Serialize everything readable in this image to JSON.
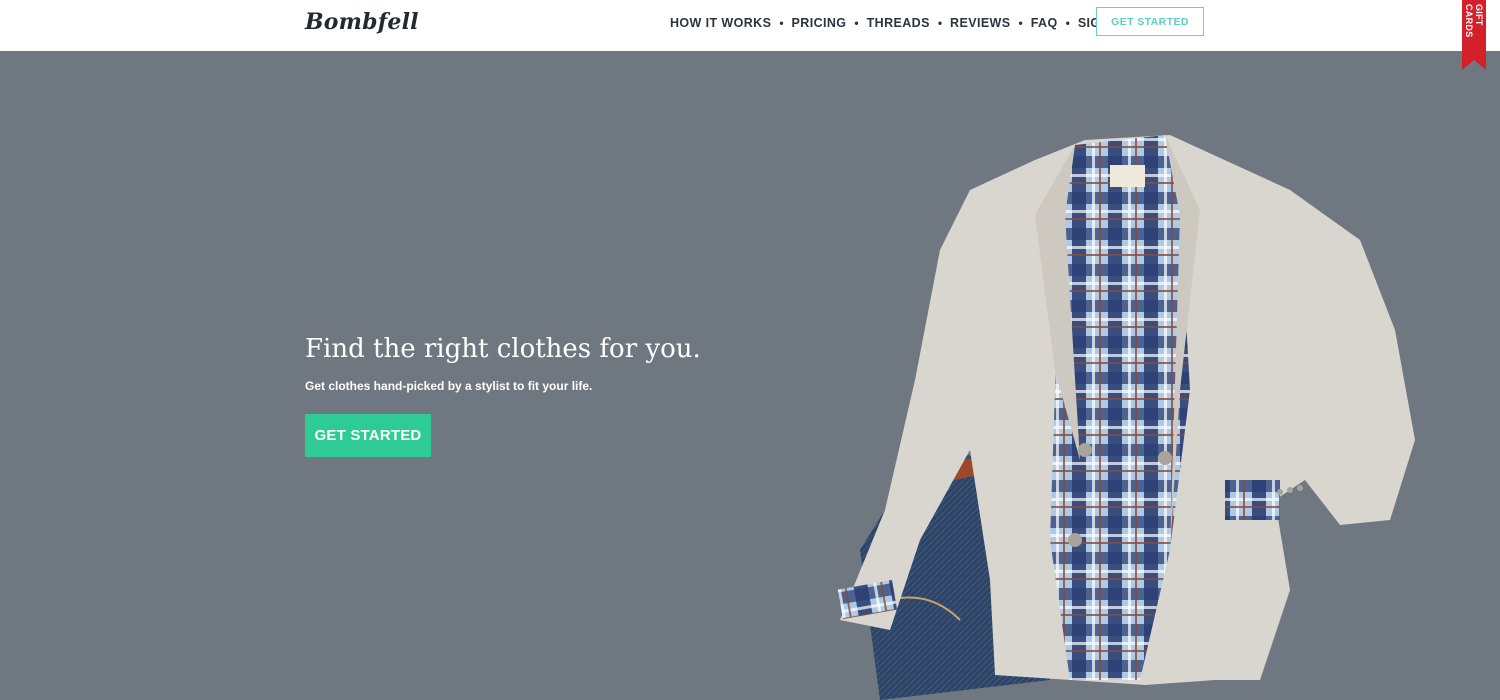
{
  "header": {
    "logo_text": "Bombfell",
    "nav": [
      {
        "label": "HOW IT WORKS"
      },
      {
        "label": "PRICING"
      },
      {
        "label": "THREADS"
      },
      {
        "label": "REVIEWS"
      },
      {
        "label": "FAQ"
      },
      {
        "label": "SIGN IN"
      }
    ],
    "separator": "•",
    "cta_label": "GET STARTED",
    "gift_ribbon_label": "GIFT CARDS"
  },
  "hero": {
    "title": "Find the right clothes for you.",
    "subtitle": "Get clothes hand-picked by a stylist to fit your life.",
    "cta_label": "GET STARTED",
    "image_icon": "clothing-outfit-illustration"
  },
  "colors": {
    "background": "#6f7781",
    "header_bg": "#ffffff",
    "accent_teal": "#5ccfbf",
    "cta_green": "#2ecb95",
    "ribbon_red": "#d3202a",
    "text_dark": "#2b3440"
  }
}
